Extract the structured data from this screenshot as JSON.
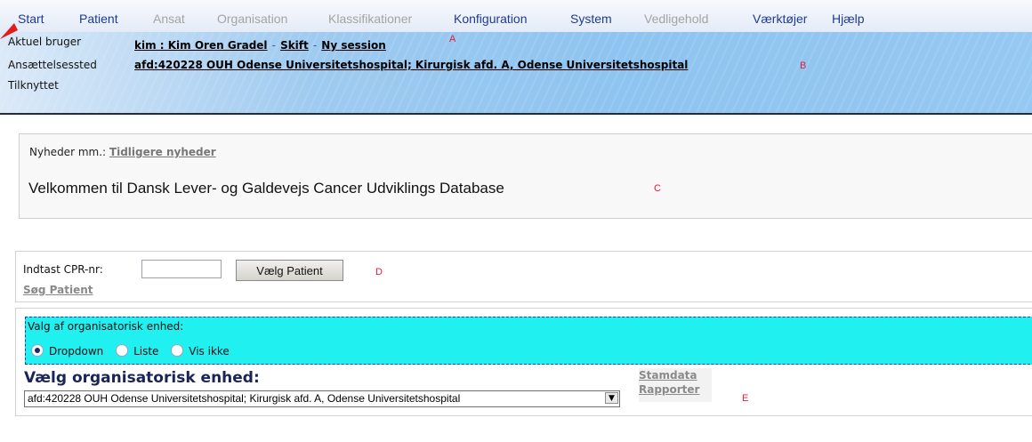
{
  "menu": [
    {
      "label": "Start",
      "enabled": true
    },
    {
      "label": "Patient",
      "enabled": true
    },
    {
      "label": "Ansat",
      "enabled": false
    },
    {
      "label": "Organisation",
      "enabled": false
    },
    {
      "label": "Klassifikationer",
      "enabled": false
    },
    {
      "label": "Konfiguration",
      "enabled": true
    },
    {
      "label": "System",
      "enabled": true
    },
    {
      "label": "Vedligehold",
      "enabled": false
    },
    {
      "label": "Værktøjer",
      "enabled": true
    },
    {
      "label": "Hjælp",
      "enabled": true
    }
  ],
  "header": {
    "user_label": "Aktuel bruger",
    "user_link": "kim : Kim Oren Gradel",
    "sep": "-",
    "switch_link": "Skift",
    "new_session_link": "Ny session",
    "employment_label": "Ansættelsessted",
    "employment_link": "afd:420228 OUH Odense Universitetshospital; Kirurgisk afd. A, Odense Universitetshospital",
    "attached_label": "Tilknyttet"
  },
  "markers": {
    "a": "A",
    "b": "B",
    "c": "C",
    "d": "D",
    "e": "E"
  },
  "news": {
    "label": "Nyheder mm.:",
    "link": "Tidligere nyheder",
    "welcome": "Velkommen til Dansk Lever- og Galdevejs Cancer Udviklings Database"
  },
  "patient": {
    "cpr_label": "Indtast CPR-nr:",
    "cpr_value": "",
    "select_button": "Vælg Patient",
    "search_link": "Søg Patient"
  },
  "org": {
    "choice_title": "Valg af organisatorisk enhed:",
    "options": [
      "Dropdown",
      "Liste",
      "Vis ikke"
    ],
    "selected_option": "Dropdown",
    "heading": "Vælg organisatorisk enhed:",
    "select_value": "afd:420228 OUH Odense Universitetshospital; Kirurgisk afd. A, Odense Universitetshospital",
    "links": [
      "Stamdata",
      "Rapporter"
    ]
  },
  "colors": {
    "menu_enabled": "#1f3a93",
    "menu_disabled": "#a4a4a4",
    "cyan_panel": "#21f0f0",
    "annotation_marker": "#e2203a"
  }
}
